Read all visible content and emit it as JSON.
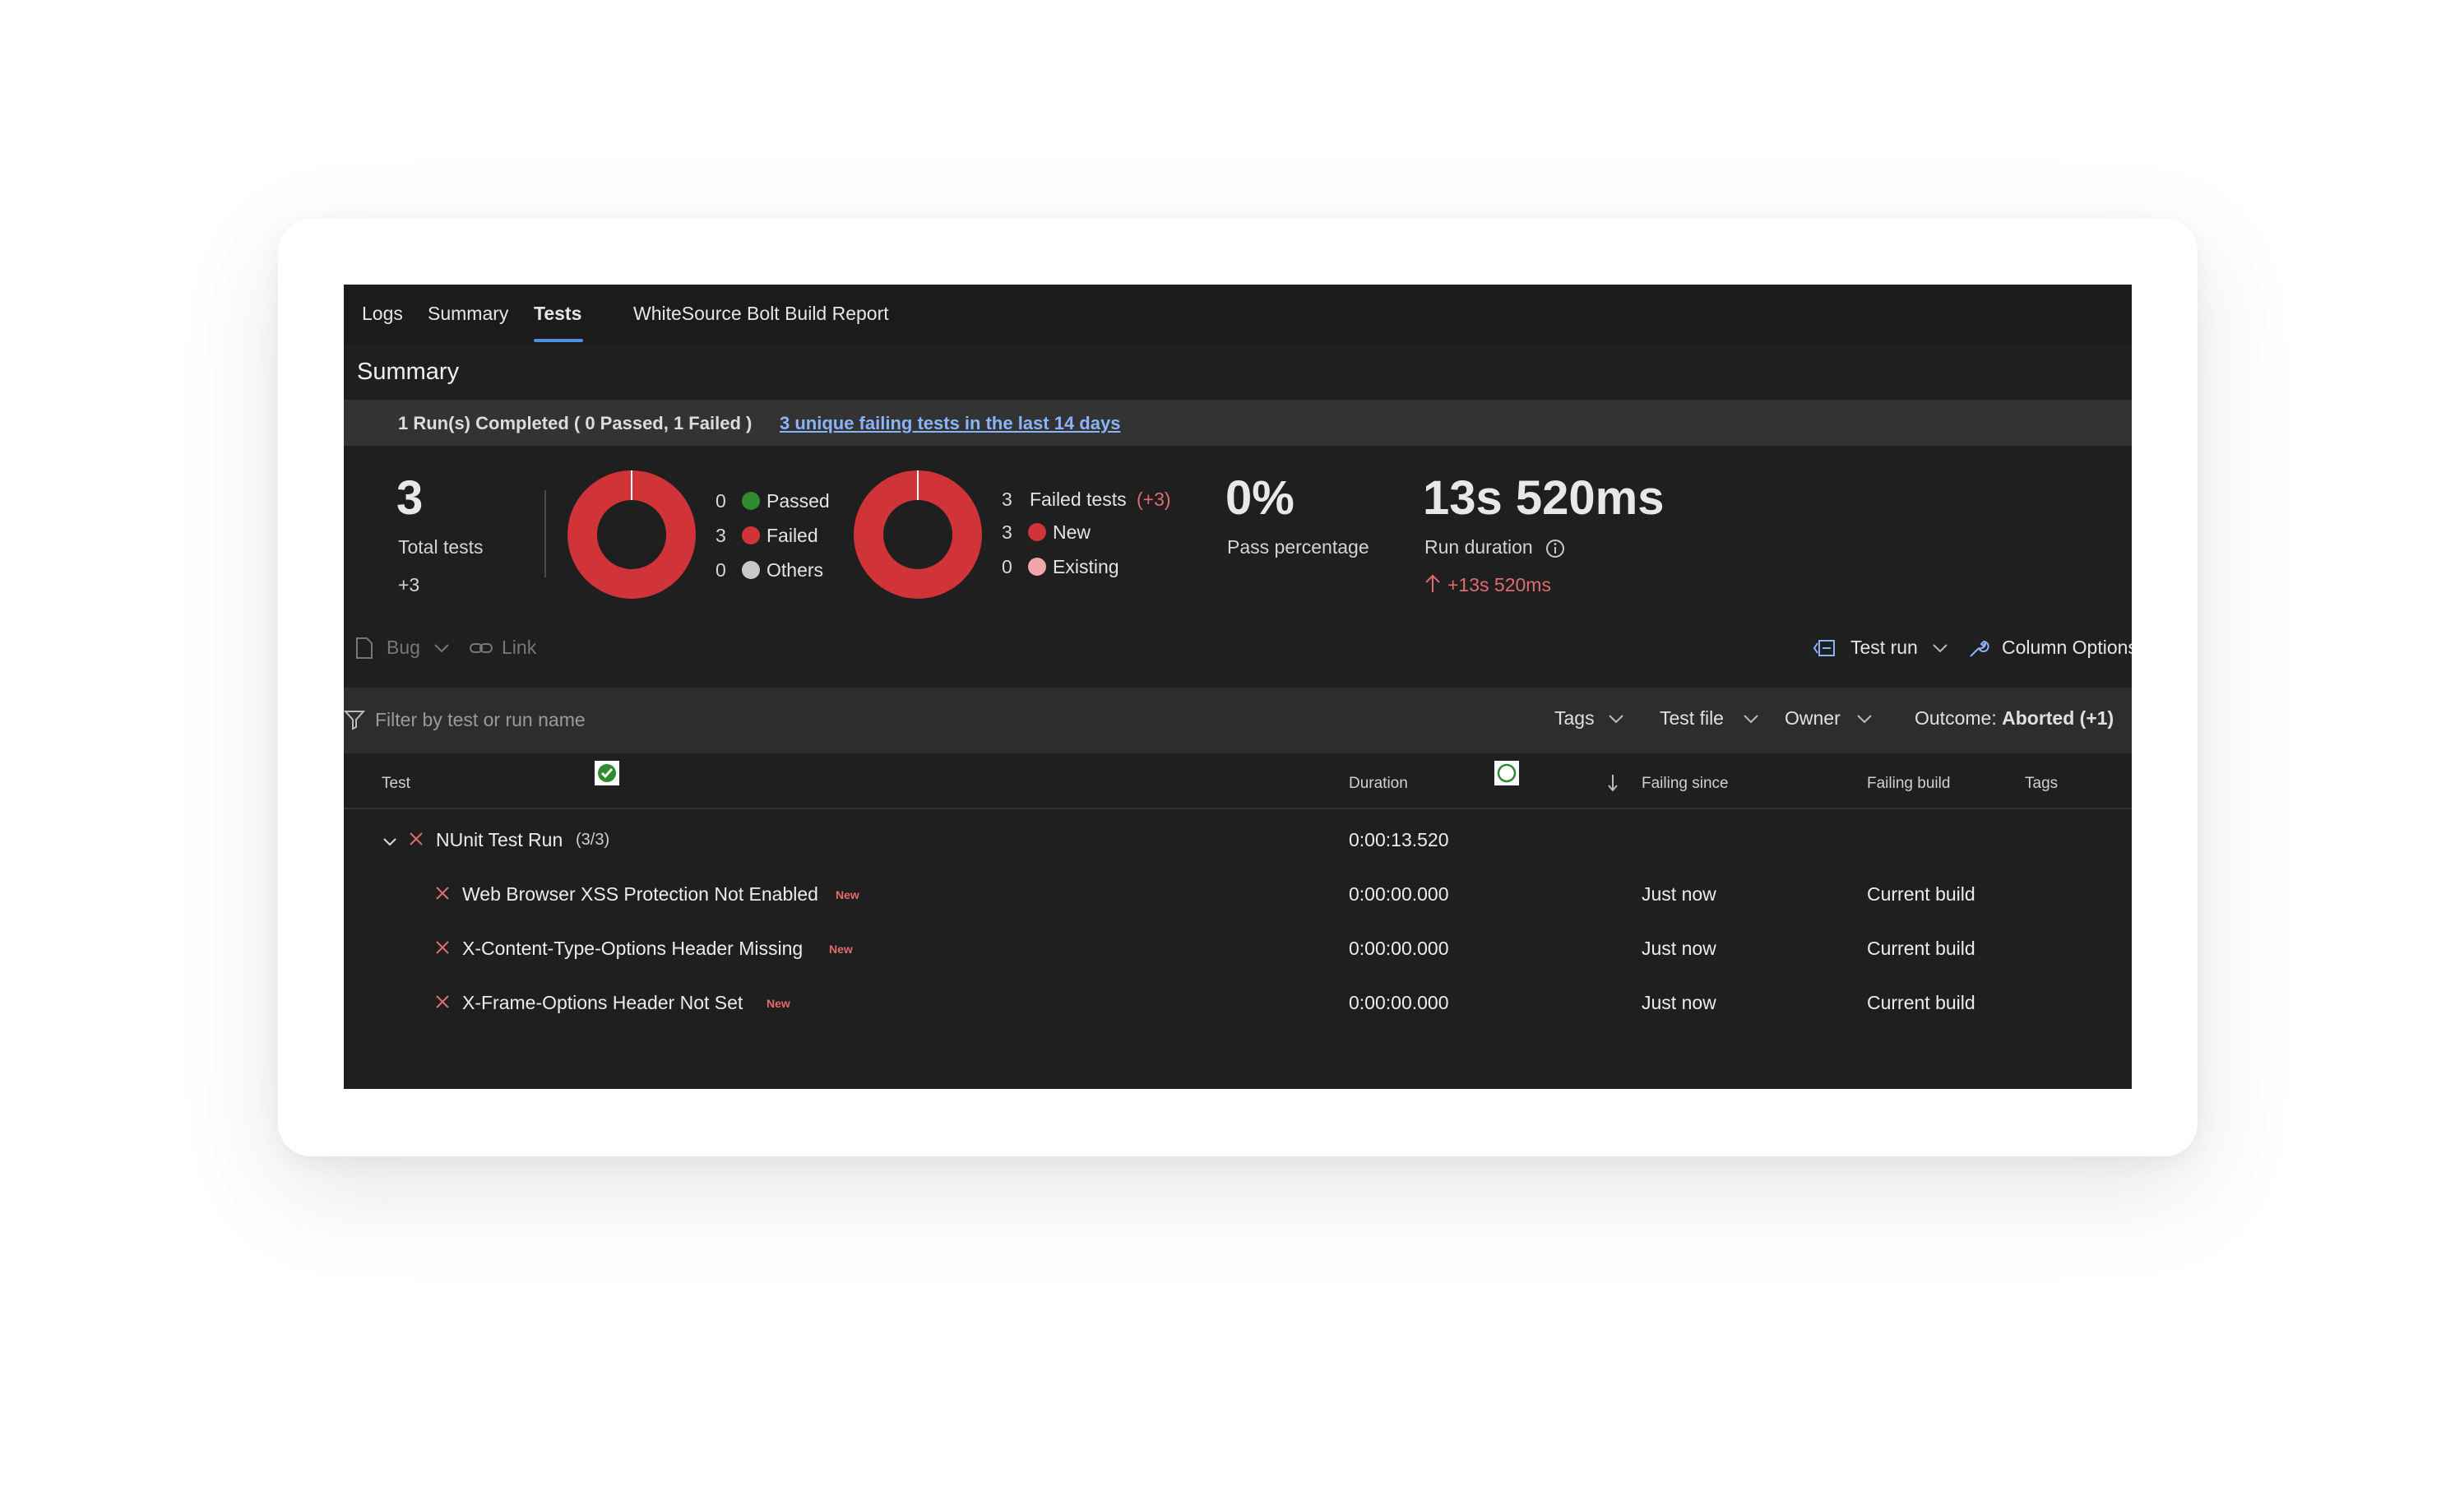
{
  "tabs": [
    {
      "label": "Logs",
      "active": false
    },
    {
      "label": "Summary",
      "active": false
    },
    {
      "label": "Tests",
      "active": true
    },
    {
      "label": "WhiteSource Bolt Build Report",
      "active": false
    }
  ],
  "summary": {
    "title": "Summary",
    "run_status": "1 Run(s) Completed ( 0 Passed, 1 Failed )",
    "failing_link": "3 unique failing tests in the last 14 days"
  },
  "stats": {
    "total_tests": "3",
    "total_tests_label": "Total tests",
    "total_delta": "+3",
    "outcome_legend": [
      {
        "count": "0",
        "label": "Passed",
        "color": "#2e8b2e"
      },
      {
        "count": "3",
        "label": "Failed",
        "color": "#d13438"
      },
      {
        "count": "0",
        "label": "Others",
        "color": "#c8c8c8"
      }
    ],
    "failed_legend_title": "Failed tests",
    "failed_legend_title_count": "3",
    "failed_legend_delta": "(+3)",
    "failed_legend": [
      {
        "count": "3",
        "label": "New",
        "color": "#d13438"
      },
      {
        "count": "0",
        "label": "Existing",
        "color": "#f1a7a7"
      }
    ],
    "pass_percentage": "0%",
    "pass_percentage_label": "Pass percentage",
    "run_duration": "13s 520ms",
    "run_duration_label": "Run duration",
    "run_duration_delta": "+13s 520ms"
  },
  "donut_colors": {
    "failed": "#d13438"
  },
  "toolbar": {
    "bug_label": "Bug",
    "link_label": "Link",
    "test_run_label": "Test run",
    "column_options_label": "Column Options"
  },
  "filter": {
    "placeholder": "Filter by test or run name",
    "tags_label": "Tags",
    "test_file_label": "Test file",
    "owner_label": "Owner",
    "outcome_prefix": "Outcome:",
    "outcome_value": "Aborted (+1)"
  },
  "table": {
    "headers": {
      "test": "Test",
      "duration": "Duration",
      "failing_since": "Failing since",
      "failing_build": "Failing build",
      "tags": "Tags"
    },
    "group": {
      "name": "NUnit Test Run",
      "count": "(3/3)",
      "duration": "0:00:13.520"
    },
    "rows": [
      {
        "name": "Web Browser XSS Protection Not Enabled",
        "badge": "New",
        "duration": "0:00:00.000",
        "failing_since": "Just now",
        "failing_build": "Current build"
      },
      {
        "name": "X-Content-Type-Options Header Missing",
        "badge": "New",
        "duration": "0:00:00.000",
        "failing_since": "Just now",
        "failing_build": "Current build"
      },
      {
        "name": "X-Frame-Options Header Not Set",
        "badge": "New",
        "duration": "0:00:00.000",
        "failing_since": "Just now",
        "failing_build": "Current build"
      }
    ]
  }
}
